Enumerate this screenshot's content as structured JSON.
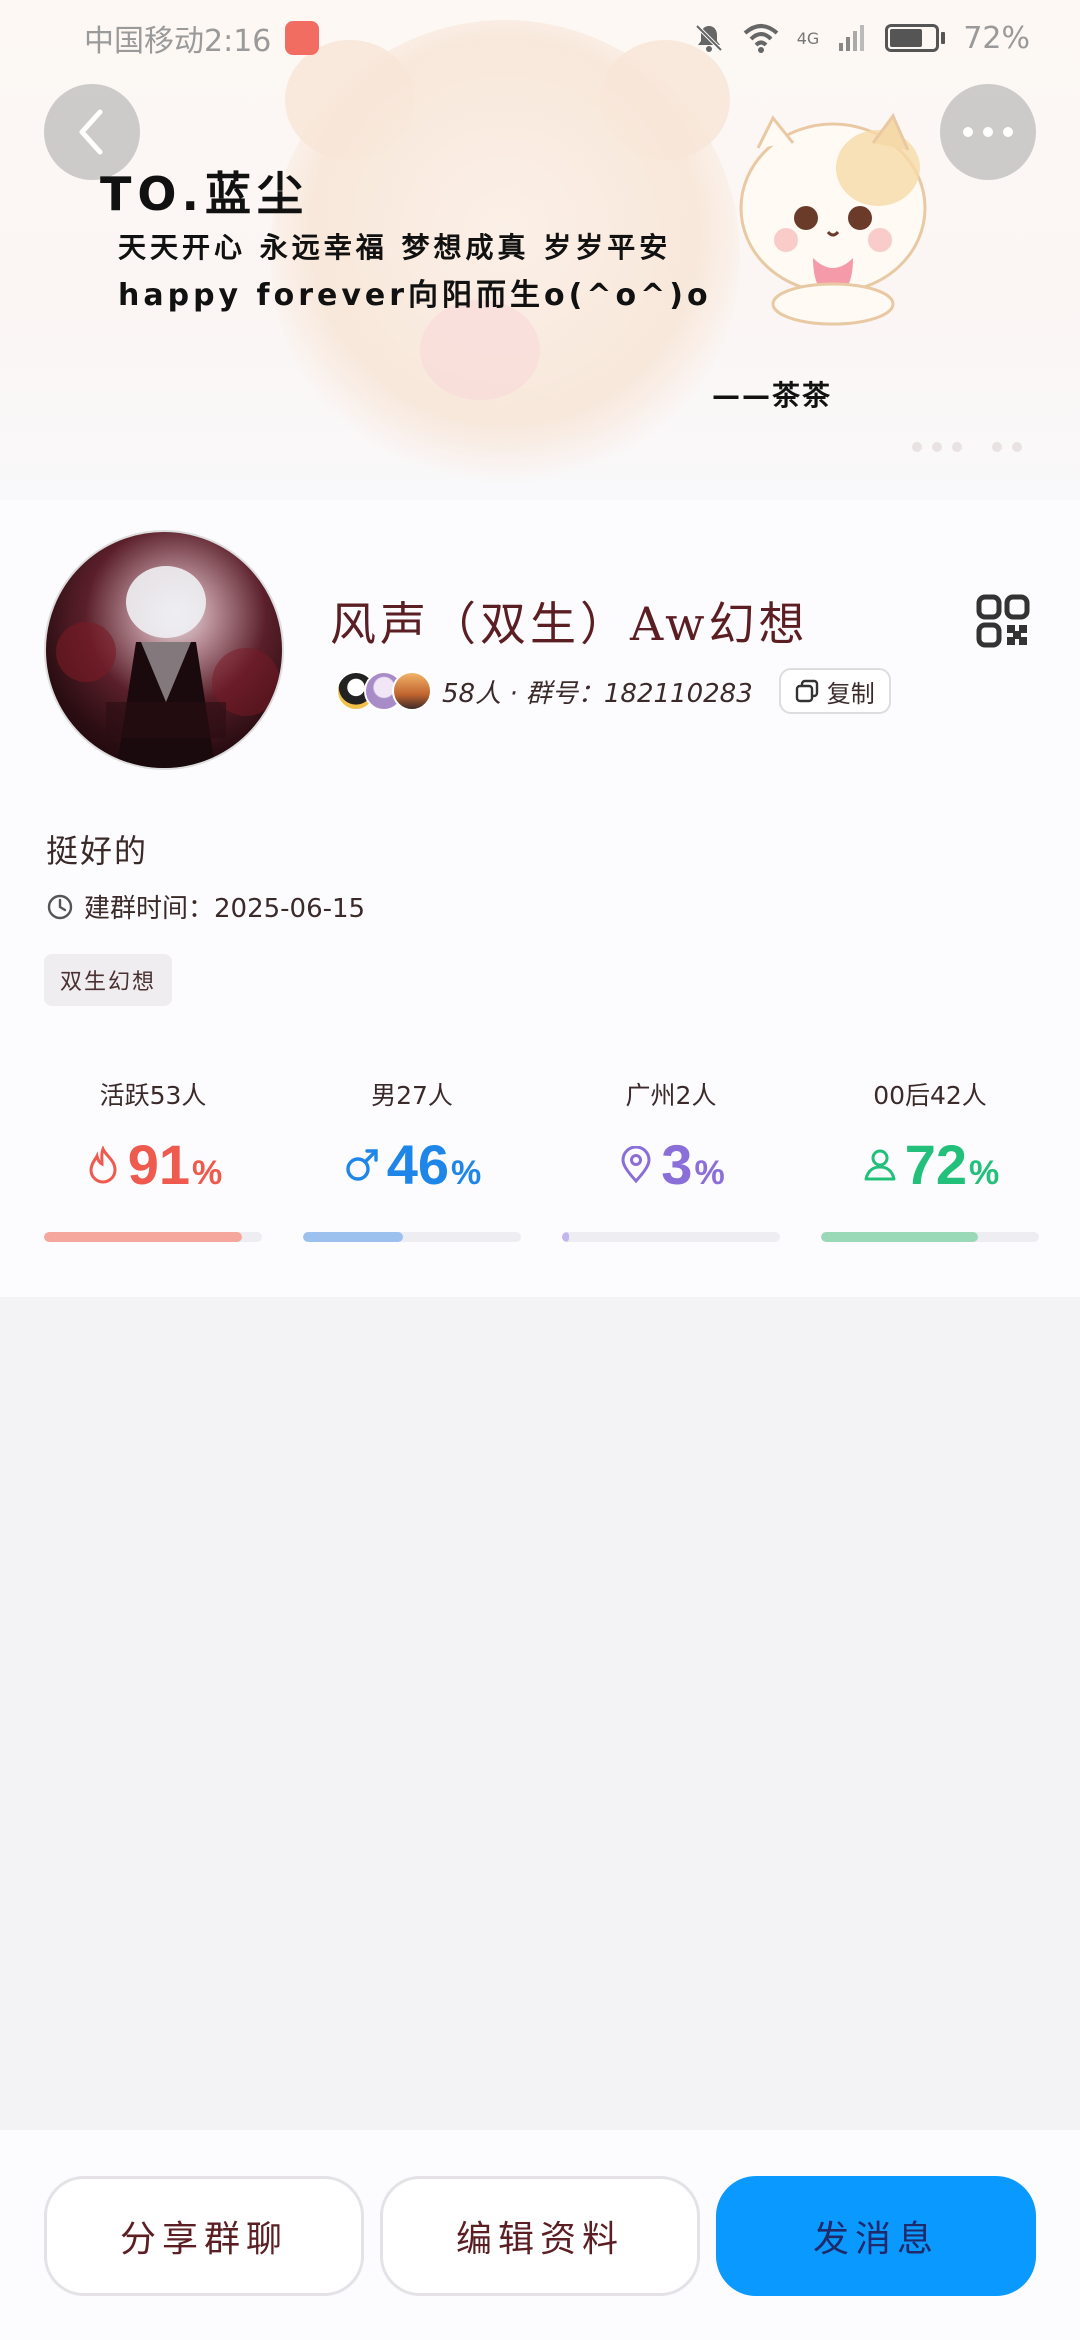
{
  "status_bar": {
    "carrier_time": "中国移动2:16",
    "network": "4G",
    "battery": "72%",
    "battery_level": 0.72
  },
  "banner": {
    "to_line": "TO.蓝尘",
    "line1": "天天开心 永远幸福 梦想成真 岁岁平安",
    "line2": "happy forever向阳而生o(^o^)o",
    "signature": "——茶茶"
  },
  "profile": {
    "group_name": "风声（双生）Aw幻想",
    "member_info": "58人 · 群号：182110283",
    "copy_label": "复制",
    "intro": "挺好的",
    "created": "建群时间：2025-06-15",
    "tag": "双生幻想"
  },
  "stats": [
    {
      "label": "活跃53人",
      "value": "91",
      "unit": "%",
      "fraction": 0.91,
      "color": "#ee5a4d",
      "track_color": "#f5a79e",
      "icon": "flame-icon"
    },
    {
      "label": "男27人",
      "value": "46",
      "unit": "%",
      "fraction": 0.46,
      "color": "#1e86e8",
      "track_color": "#9cc1ef",
      "icon": "male-icon"
    },
    {
      "label": "广州2人",
      "value": "3",
      "unit": "%",
      "fraction": 0.03,
      "color": "#8a6fd8",
      "track_color": "#c3b6ee",
      "icon": "location-icon"
    },
    {
      "label": "00后42人",
      "value": "72",
      "unit": "%",
      "fraction": 0.72,
      "color": "#22c07a",
      "track_color": "#9ad9b7",
      "icon": "person-icon"
    }
  ],
  "actions": {
    "share": "分享群聊",
    "edit": "编辑资料",
    "message": "发消息"
  }
}
